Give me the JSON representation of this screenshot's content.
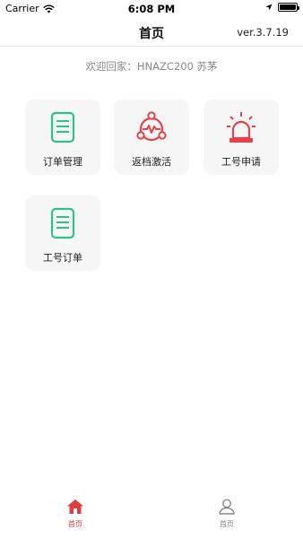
{
  "status_bar": {
    "carrier": "Carrier",
    "time": "6:08 PM"
  },
  "nav": {
    "title": "首页",
    "version": "ver.3.7.19"
  },
  "welcome": "欢迎回家：HNAZC200 苏茅",
  "tiles": [
    {
      "label": "订单管理",
      "icon": "document-icon",
      "color": "#2ec28a"
    },
    {
      "label": "返档激活",
      "icon": "network-activate-icon",
      "color": "#e8414a"
    },
    {
      "label": "工号申请",
      "icon": "alarm-light-icon",
      "color": "#e8414a"
    },
    {
      "label": "工号订单",
      "icon": "document-icon",
      "color": "#2ec28a"
    }
  ],
  "tabbar": {
    "home_label": "首页",
    "profile_label": "首页",
    "active_color": "#e23b3b",
    "inactive_color": "#888888"
  }
}
